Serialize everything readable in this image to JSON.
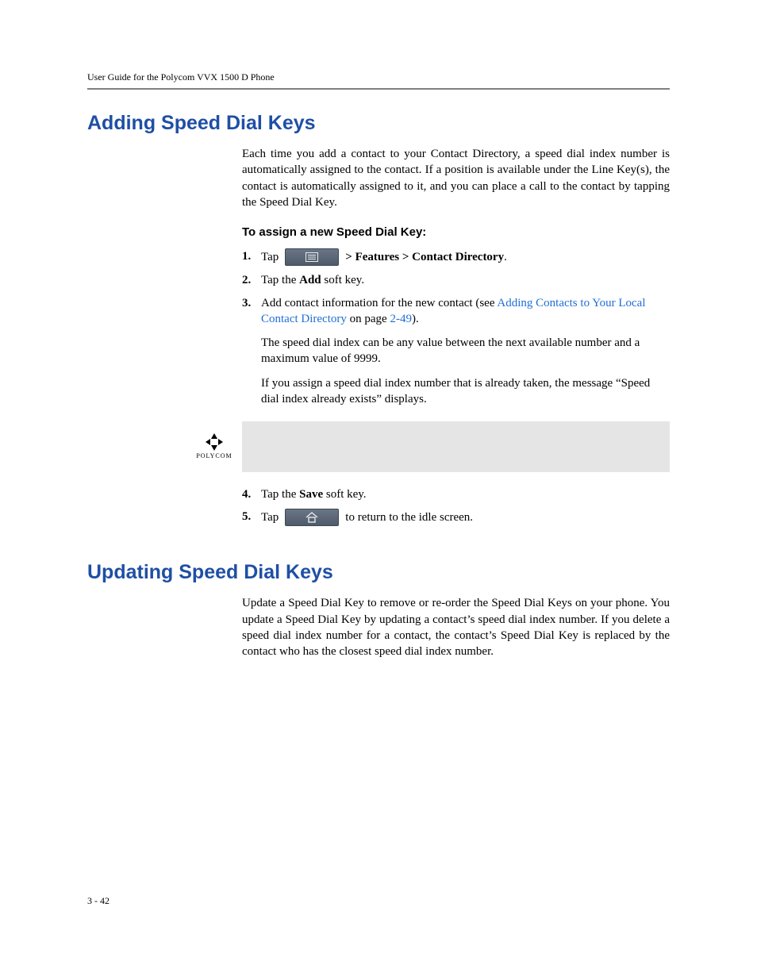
{
  "header": {
    "runningHead": "User Guide for the Polycom VVX 1500 D Phone"
  },
  "section1": {
    "title": "Adding Speed Dial Keys",
    "intro": "Each time you add a contact to your Contact Directory, a speed dial index number is automatically assigned to the contact. If a position is available under the Line Key(s), the contact is automatically assigned to it, and you can place a call to the contact by tapping the Speed Dial Key.",
    "procTitle": "To assign a new Speed Dial Key:",
    "steps": {
      "s1": {
        "num": "1.",
        "pre": "Tap",
        "post": " > Features > Contact Directory",
        "period": "."
      },
      "s2": {
        "num": "2.",
        "pre": "Tap the ",
        "bold": "Add",
        "post": " soft key."
      },
      "s3": {
        "num": "3.",
        "pre": "Add contact information for the new contact (see ",
        "link1": "Adding Contacts to Your Local Contact Directory",
        "mid": " on page ",
        "link2": "2-49",
        "post": ").",
        "p2": "The speed dial index can be any value between the next available number and a maximum value of 9999.",
        "p3": "If you assign a speed dial index number that is already taken, the message “Speed dial index already exists” displays."
      },
      "s4": {
        "num": "4.",
        "pre": "Tap the ",
        "bold": "Save",
        "post": " soft key."
      },
      "s5": {
        "num": "5.",
        "pre": "Tap",
        "post": " to return to the idle screen."
      }
    },
    "calloutLogo": "POLYCOM"
  },
  "section2": {
    "title": "Updating Speed Dial Keys",
    "intro": "Update a Speed Dial Key to remove or re-order the Speed Dial Keys on your phone. You update a Speed Dial Key by updating a contact’s speed dial index number. If you delete a speed dial index number for a contact, the contact’s Speed Dial Key is replaced by the contact who has the closest speed dial index number."
  },
  "footer": {
    "pageNum": "3 - 42"
  }
}
